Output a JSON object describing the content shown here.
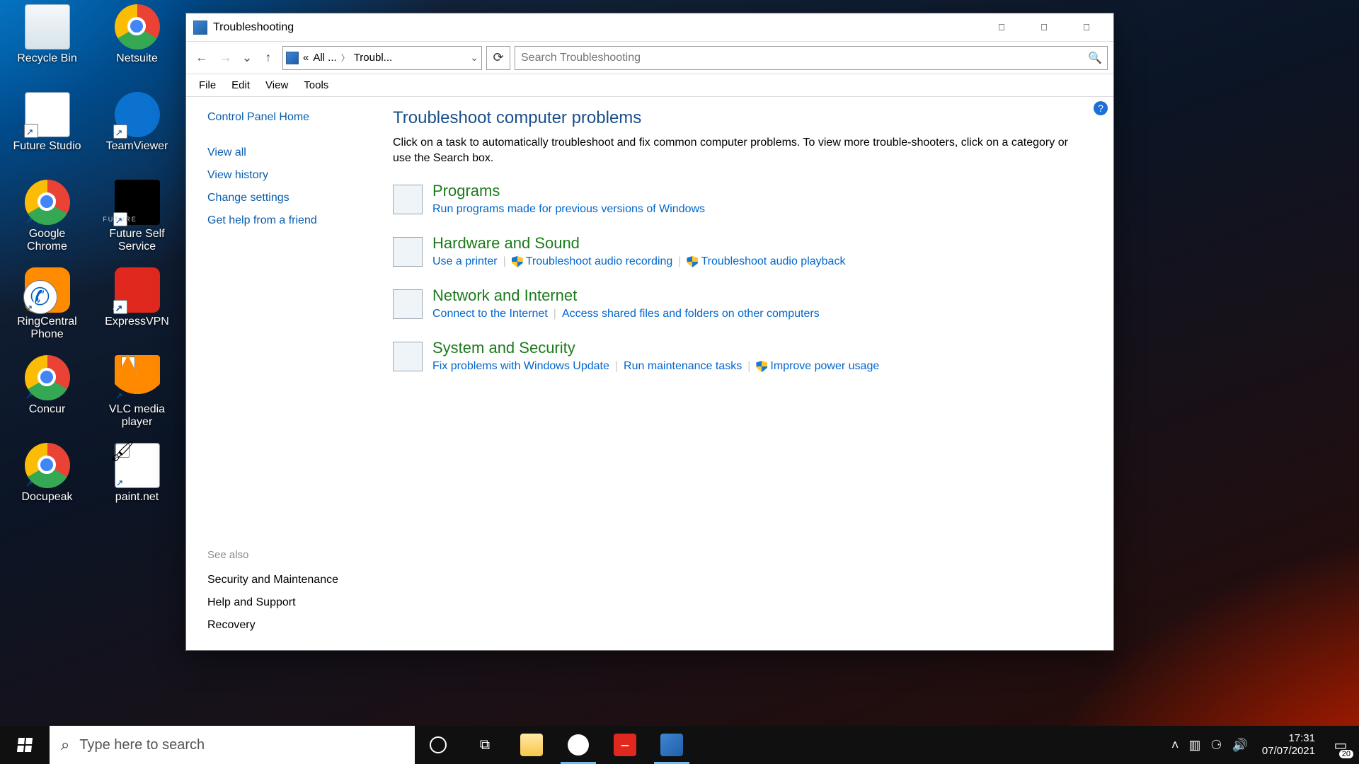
{
  "window": {
    "title": "Troubleshooting",
    "breadcrumb": {
      "root": "«",
      "mid": "All ...",
      "leaf": "Troubl..."
    },
    "search_placeholder": "Search Troubleshooting",
    "menubar": [
      "File",
      "Edit",
      "View",
      "Tools"
    ]
  },
  "sidebar": {
    "links": [
      "Control Panel Home",
      "View all",
      "View history",
      "Change settings",
      "Get help from a friend"
    ],
    "see_also_label": "See also",
    "see_also": [
      "Security and Maintenance",
      "Help and Support",
      "Recovery"
    ]
  },
  "content": {
    "title": "Troubleshoot computer problems",
    "desc": "Click on a task to automatically troubleshoot and fix common computer problems. To view more trouble-shooters, click on a category or use the Search box.",
    "categories": [
      {
        "title": "Programs",
        "links": [
          {
            "label": "Run programs made for previous versions of Windows",
            "shield": false
          }
        ]
      },
      {
        "title": "Hardware and Sound",
        "links": [
          {
            "label": "Use a printer",
            "shield": false
          },
          {
            "label": "Troubleshoot audio recording",
            "shield": true
          },
          {
            "label": "Troubleshoot audio playback",
            "shield": true
          }
        ]
      },
      {
        "title": "Network and Internet",
        "links": [
          {
            "label": "Connect to the Internet",
            "shield": false
          },
          {
            "label": "Access shared files and folders on other computers",
            "shield": false
          }
        ]
      },
      {
        "title": "System and Security",
        "links": [
          {
            "label": "Fix problems with Windows Update",
            "shield": false
          },
          {
            "label": "Run maintenance tasks",
            "shield": false
          },
          {
            "label": "Improve power usage",
            "shield": true
          }
        ]
      }
    ]
  },
  "desktop_icons": [
    {
      "label": "Recycle Bin",
      "face": "face-bin",
      "shortcut": false
    },
    {
      "label": "Netsuite",
      "face": "face-chrome",
      "shortcut": true
    },
    {
      "label": "Future Studio",
      "face": "face-doc",
      "shortcut": true
    },
    {
      "label": "TeamViewer",
      "face": "face-teamviewer",
      "shortcut": true
    },
    {
      "label": "Google Chrome",
      "face": "face-chrome",
      "shortcut": true
    },
    {
      "label": "Future Self Service",
      "face": "face-black",
      "shortcut": true
    },
    {
      "label": "RingCentral Phone",
      "face": "face-ring",
      "shortcut": true
    },
    {
      "label": "ExpressVPN",
      "face": "face-expressvpn",
      "shortcut": true
    },
    {
      "label": "Concur",
      "face": "face-chrome",
      "shortcut": true
    },
    {
      "label": "VLC media player",
      "face": "face-vlc",
      "shortcut": true
    },
    {
      "label": "Docupeak",
      "face": "face-chrome",
      "shortcut": true
    },
    {
      "label": "paint.net",
      "face": "face-paint",
      "shortcut": true
    }
  ],
  "taskbar": {
    "search_placeholder": "Type here to search",
    "time": "17:31",
    "date": "07/07/2021",
    "notif_count": "20"
  }
}
